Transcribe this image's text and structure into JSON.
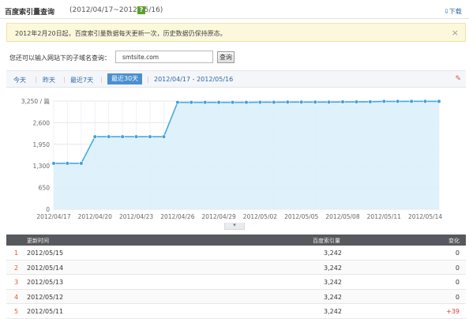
{
  "header": {
    "title": "百度索引量查询",
    "range": "(2012/04/17~2012/05/16)",
    "help": "?",
    "download": "下载"
  },
  "notice": {
    "text": "2012年2月20日起，百度索引量数据每天更新一次，历史数据仍保持原态。",
    "close": "×"
  },
  "query": {
    "label": "您还可以输入网站下的子域名查询：",
    "value": "smtsite.com",
    "button": "查询"
  },
  "periods": {
    "items": [
      "今天",
      "昨天",
      "最近7天",
      "最近30天"
    ],
    "active_index": 3,
    "date_range": "2012/04/17 - 2012/05/16"
  },
  "chart_data": {
    "type": "area",
    "y_unit_label": "3,250 / 篇",
    "yticks": [
      "3,250 / 篇",
      "2,600",
      "1,950",
      "1,300",
      "650",
      "0"
    ],
    "ylim": [
      0,
      3250
    ],
    "x_tick_labels": [
      "2012/04/17",
      "2012/04/20",
      "2012/04/23",
      "2012/04/26",
      "2012/04/29",
      "2012/05/02",
      "2012/05/05",
      "2012/05/08",
      "2012/05/11",
      "2012/05/14"
    ],
    "x": [
      "2012/04/17",
      "2012/04/18",
      "2012/04/19",
      "2012/04/20",
      "2012/04/21",
      "2012/04/22",
      "2012/04/23",
      "2012/04/24",
      "2012/04/25",
      "2012/04/26",
      "2012/04/27",
      "2012/04/28",
      "2012/04/29",
      "2012/04/30",
      "2012/05/01",
      "2012/05/02",
      "2012/05/03",
      "2012/05/04",
      "2012/05/05",
      "2012/05/06",
      "2012/05/07",
      "2012/05/08",
      "2012/05/09",
      "2012/05/10",
      "2012/05/11",
      "2012/05/12",
      "2012/05/13",
      "2012/05/14",
      "2012/05/15"
    ],
    "values": [
      1380,
      1380,
      1380,
      2180,
      2180,
      2180,
      2180,
      2180,
      2180,
      3210,
      3210,
      3210,
      3210,
      3210,
      3210,
      3215,
      3215,
      3220,
      3220,
      3220,
      3220,
      3225,
      3225,
      3230,
      3240,
      3240,
      3242,
      3242,
      3242
    ],
    "grid": true,
    "colors": {
      "line": "#4aa8e0",
      "fill": "#dcf0fb",
      "point": "#3aa0e0"
    }
  },
  "table": {
    "headers": [
      "更新时间",
      "百度索引量",
      "变化"
    ],
    "rows": [
      {
        "index": "1",
        "date": "2012/05/15",
        "value": "3,242",
        "change": "0"
      },
      {
        "index": "2",
        "date": "2012/05/14",
        "value": "3,242",
        "change": "0"
      },
      {
        "index": "3",
        "date": "2012/05/13",
        "value": "3,242",
        "change": "0"
      },
      {
        "index": "4",
        "date": "2012/05/12",
        "value": "3,242",
        "change": "0"
      },
      {
        "index": "5",
        "date": "2012/05/11",
        "value": "3,242",
        "change": "+39"
      }
    ]
  }
}
